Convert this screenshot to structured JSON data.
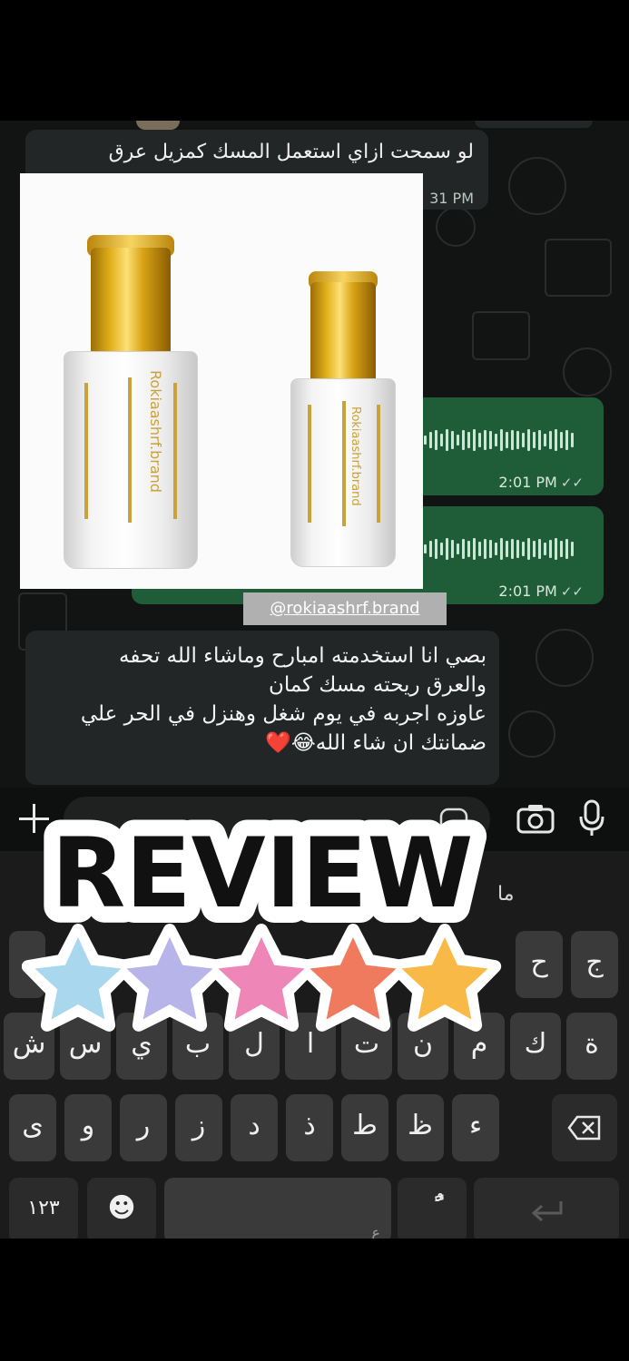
{
  "chat": {
    "top_quoted_message": "لو سمحت ازاي استعمل المسك كمزيل عرق",
    "top_time": "31 PM",
    "voice_notes": [
      {
        "time": "2:01 PM",
        "status": "✓✓"
      },
      {
        "time": "2:01 PM",
        "status": "✓✓"
      }
    ],
    "photo_brand_text": "Rokiaashrf.brand",
    "watermark": "@rokiaashrf.brand",
    "reply_lines": [
      "بصي انا استخدمته امبارح وماشاء الله تحفه",
      "والعرق ريحته مسك كمان",
      "عاوزه اجربه في يوم شغل وهنزل في الحر علي",
      "ضمانتك ان شاء الله😂❤️"
    ]
  },
  "input_bar": {
    "plus_icon": "plus-icon",
    "camera_icon": "camera-icon",
    "mic_icon": "mic-icon"
  },
  "keyboard": {
    "suggestion": "ما",
    "row1": [
      "ج",
      "ح"
    ],
    "row2": [
      "ة",
      "ك",
      "م",
      "ن",
      "ت",
      "ا",
      "ل",
      "ب",
      "ي",
      "س",
      "ش"
    ],
    "row3": [
      "ء",
      "ظ",
      "ط",
      "ذ",
      "د",
      "ز",
      "ر",
      "و",
      "ى"
    ],
    "numbers_key": "١٢٣",
    "emoji_key": "☻",
    "space_hint": "ع",
    "diacritic_key": "ًٌ"
  },
  "sticker": {
    "text": "REVIEW",
    "star_colors": [
      "#a9d8ee",
      "#b7b4ea",
      "#ee86b7",
      "#ef7a5e",
      "#f8b947"
    ]
  }
}
